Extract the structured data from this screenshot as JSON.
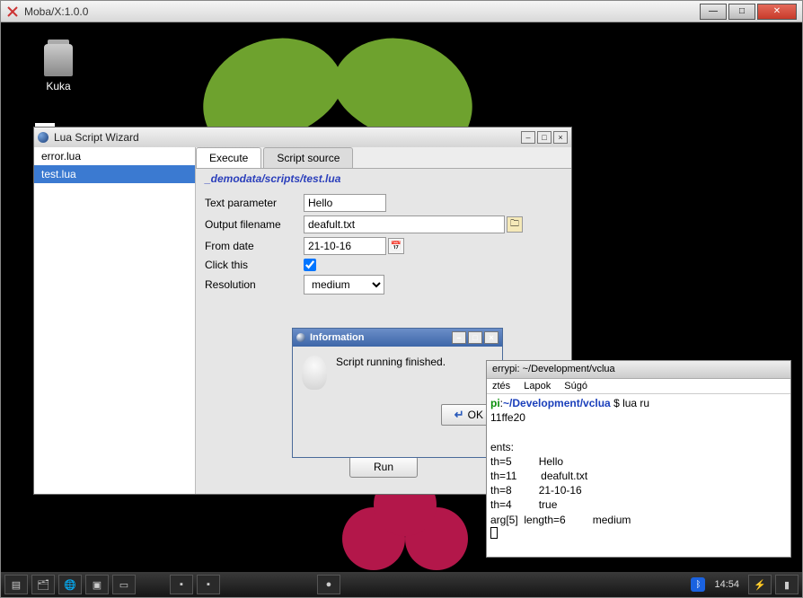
{
  "outer": {
    "title": "Moba/X:1.0.0"
  },
  "desktop": {
    "trash_label": "Kuka"
  },
  "wizard": {
    "title": "Lua Script Wizard",
    "files": [
      "error.lua",
      "test.lua"
    ],
    "selected_index": 1,
    "tabs": {
      "execute": "Execute",
      "source": "Script source"
    },
    "script_path": "_demodata/scripts/test.lua",
    "fields": {
      "text_param_label": "Text parameter",
      "text_param_value": "Hello",
      "output_filename_label": "Output filename",
      "output_filename_value": "deafult.txt",
      "from_date_label": "From date",
      "from_date_value": "21-10-16",
      "click_this_label": "Click this",
      "click_this_checked": true,
      "resolution_label": "Resolution",
      "resolution_value": "medium"
    },
    "run_label": "Run"
  },
  "info_dialog": {
    "title": "Information",
    "message": "Script running finished.",
    "ok_label": "OK"
  },
  "terminal": {
    "title": "errypi: ~/Development/vclua",
    "menu": {
      "edit": "ztés",
      "tabs": "Lapok",
      "help": "Súgó"
    },
    "prompt_host": "pi",
    "prompt_path": "~/Development/vclua",
    "prompt_tail": " $ lua ru",
    "lines": [
      "11ffe20",
      "",
      "ents:",
      "th=5         Hello",
      "th=11        deafult.txt",
      "th=8         21-10-16",
      "th=4         true",
      "arg[5]  length=6         medium"
    ]
  },
  "taskbar": {
    "clock": "14:54"
  }
}
